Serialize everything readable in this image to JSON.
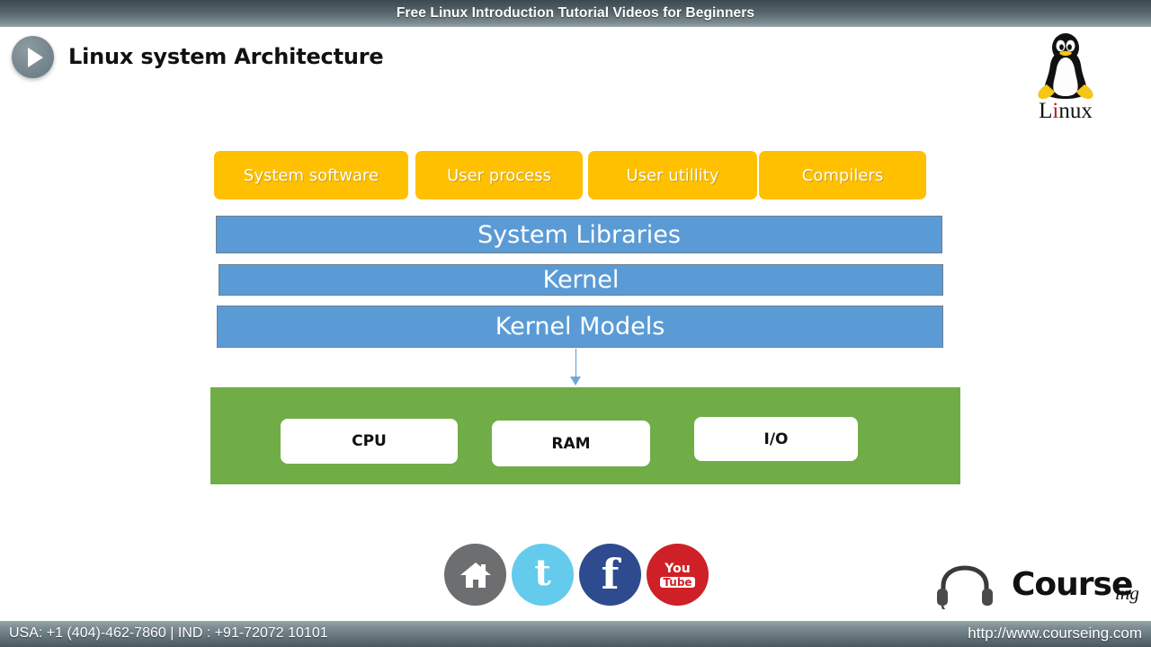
{
  "banner": {
    "text": "Free Linux Introduction Tutorial Videos for Beginners"
  },
  "header": {
    "play_icon": "play-icon",
    "title": "Linux system Architecture",
    "logo": {
      "icon": "tux-penguin-icon",
      "word_pre": "L",
      "word_dot": "i",
      "word_post": "nux"
    }
  },
  "diagram": {
    "user_layer": [
      {
        "label": "System software"
      },
      {
        "label": "User process"
      },
      {
        "label": "User utillity"
      },
      {
        "label": "Compilers"
      }
    ],
    "system_layers": [
      {
        "label": "System Libraries"
      },
      {
        "label": "Kernel"
      },
      {
        "label": "Kernel Models"
      }
    ],
    "arrow": "down-arrow-icon",
    "hardware": [
      {
        "label": "CPU"
      },
      {
        "label": "RAM"
      },
      {
        "label": "I/O"
      }
    ],
    "colors": {
      "user_layer": "#ffc000",
      "system_layer": "#5b9bd5",
      "hardware_panel": "#70ad47",
      "hardware_box": "#ffffff",
      "arrow": "#5b9bd5"
    }
  },
  "social": [
    {
      "name": "home-icon",
      "label": "",
      "color": "#6d6e70"
    },
    {
      "name": "twitter-icon",
      "label": "t",
      "color": "#64cbec"
    },
    {
      "name": "facebook-icon",
      "label": "f",
      "color": "#2f4b8f"
    },
    {
      "name": "youtube-icon",
      "label_top": "You",
      "label_bottom": "Tube",
      "color": "#ce2026"
    }
  ],
  "brand": {
    "icon": "headset-icon",
    "word": "Course",
    "suffix": "ing"
  },
  "footer": {
    "contact": "USA: +1 (404)-462-7860 | IND : +91-72072 10101",
    "website": "http://www.courseing.com"
  }
}
